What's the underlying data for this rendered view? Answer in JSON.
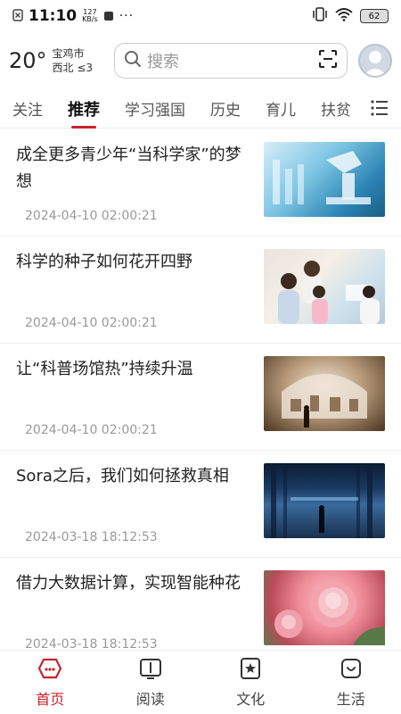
{
  "status": {
    "time": "11:10",
    "kbs_value": "127",
    "kbs_unit": "KB/s",
    "battery": "62"
  },
  "weather": {
    "temp": "20°",
    "city": "宝鸡市",
    "wind": "西北 ≤3"
  },
  "search": {
    "placeholder": "搜索"
  },
  "tabs": [
    {
      "label": "关注"
    },
    {
      "label": "推荐"
    },
    {
      "label": "学习强国"
    },
    {
      "label": "历史"
    },
    {
      "label": "育儿"
    },
    {
      "label": "扶贫"
    }
  ],
  "articles": [
    {
      "title": "成全更多青少年“当科学家”的梦想",
      "date": "2024-04-10 02:00:21"
    },
    {
      "title": "科学的种子如何花开四野",
      "date": "2024-04-10 02:00:21"
    },
    {
      "title": "让“科普场馆热”持续升温",
      "date": "2024-04-10 02:00:21"
    },
    {
      "title": "Sora之后，我们如何拯救真相",
      "date": "2024-03-18 18:12:53"
    },
    {
      "title": "借力大数据计算，实现智能种花",
      "date": "2024-03-18 18:12:53"
    }
  ],
  "nav": [
    {
      "label": "首页",
      "icon": "home-icon"
    },
    {
      "label": "阅读",
      "icon": "book-icon"
    },
    {
      "label": "文化",
      "icon": "culture-icon"
    },
    {
      "label": "生活",
      "icon": "life-icon"
    }
  ],
  "colors": {
    "accent": "#c8232b"
  }
}
